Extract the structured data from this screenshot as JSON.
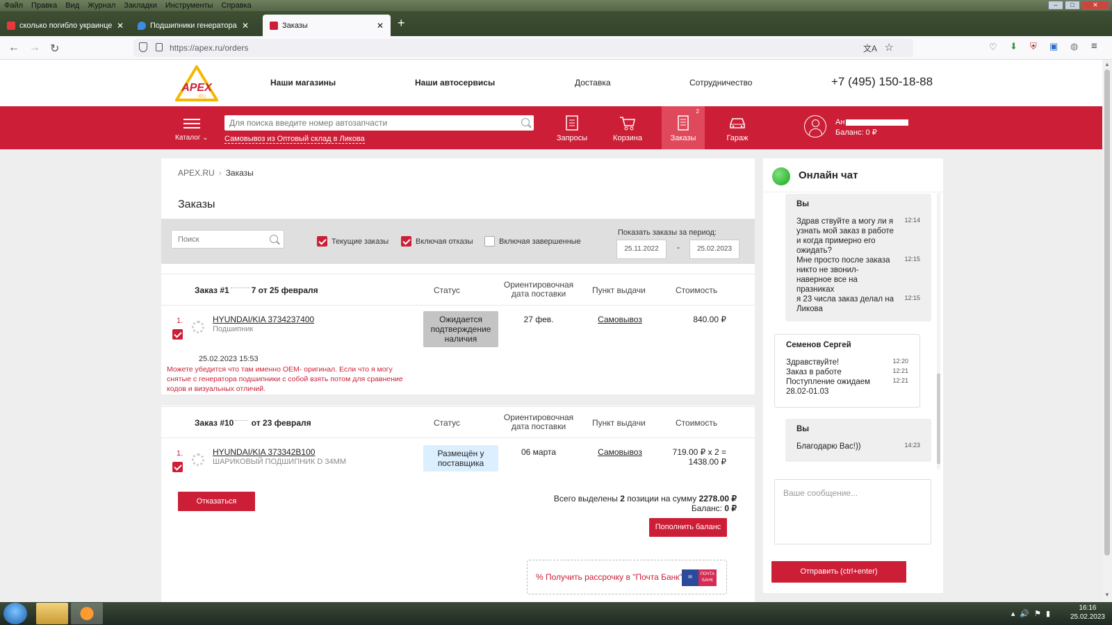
{
  "browser": {
    "menu": [
      "Файл",
      "Правка",
      "Вид",
      "Журнал",
      "Закладки",
      "Инструменты",
      "Справка"
    ],
    "tabs": [
      {
        "title": "сколько погибло украинцев н",
        "active": false,
        "color": "#e8383d"
      },
      {
        "title": "Подшипники генератора - Стр",
        "active": false,
        "color": "#3b8de0"
      },
      {
        "title": "Заказы",
        "active": true,
        "color": "#cc1f37"
      }
    ],
    "url": "https://apex.ru/orders",
    "tab_close": "✕",
    "new_tab": "+"
  },
  "site": {
    "logo_text": "APEX",
    "logo_sub": ".RU",
    "topnav": [
      "Наши магазины",
      "Наши автосервисы",
      "Доставка",
      "Сотрудничество"
    ],
    "phone": "+7 (495) 150-18-88",
    "catalog_label": "Каталог",
    "search_placeholder": "Для поиска введите номер автозапчасти",
    "pickup_point": "Самовывоз из Оптовый склад в Ликова",
    "nav": {
      "requests": "Запросы",
      "cart": "Корзина",
      "orders": "Заказы",
      "orders_badge": "2",
      "garage": "Гараж"
    },
    "user_name": "Ан",
    "user_balance": "Баланс: 0 ₽"
  },
  "main": {
    "breadcrumb": [
      "APEX.RU",
      "Заказы"
    ],
    "title": "Заказы",
    "filters": {
      "search_placeholder": "Поиск",
      "current_label": "Текущие заказы",
      "refusals_label": "Включая отказы",
      "completed_label": "Включая завершенные",
      "period_label": "Показать заказы за период:",
      "date_from": "25.11.2022",
      "date_to": "25.02.2023",
      "dash": "-"
    },
    "columns": {
      "status": "Статус",
      "delivery": "Ориентировочная дата поставки",
      "pickup": "Пункт выдачи",
      "cost": "Стоимость"
    },
    "orders": [
      {
        "title_a": "Заказ #1",
        "title_b": "7  от 25 февраля",
        "num": "1.",
        "part": "HYUNDAI/KIA 3734237400",
        "part_name": "Подшипник",
        "status": "Ожидается подтверждение наличия",
        "delivery": "27 фев.",
        "pickup": "Самовывоз",
        "cost": "840.00 ₽",
        "comment_date": "25.02.2023 15:53",
        "comment": "Можете убедится что там именно OEM- оригинал. Если что я могу снятые с генератора подшипники с собой взять потом для сравнение кодов и визуальных отличий."
      },
      {
        "title_a": "Заказ #10",
        "title_b": " от 23 февраля",
        "num": "1.",
        "part": "HYUNDAI/KIA 373342B100",
        "part_name": "ШАРИКОВЫЙ ПОДШИПНИК D 34MM",
        "status": "Размещён у поставщика",
        "delivery": "06 марта",
        "pickup": "Самовывоз",
        "cost_line1": "719.00 ₽ x 2 =",
        "cost_line2": "1438.00 ₽"
      }
    ],
    "refuse_button": "Отказаться",
    "summary_prefix": "Всего выделены",
    "summary_count": "2",
    "summary_mid": "позиции на сумму",
    "summary_total": "2278.00 ₽",
    "balance_label": "Баланс:",
    "balance_value": "0 ₽",
    "topup_button": "Пополнить баланс",
    "installment_text": "% Получить рассрочку в \"Почта Банк\"",
    "postbank_text": "ПОЧТА БАНК"
  },
  "chat": {
    "title": "Онлайн чат",
    "messages": [
      {
        "who": "Вы",
        "lines": [
          "Здрав ствуйте а могу ли я",
          "узнать мой заказ в работе",
          "и когда примерно его",
          "ожидать?",
          "Мне просто после заказа",
          "никто не звонил-",
          "наверное все на",
          "празниках",
          "я 23 числа заказ делал на",
          "Ликова"
        ],
        "times": [
          "12:14",
          "12:15",
          "12:15"
        ]
      },
      {
        "who": "Семенов Сергей",
        "lines": [
          "Здравствуйте!",
          "Заказ в работе",
          "Поступление ожидаем",
          "28.02-01.03"
        ],
        "times": [
          "12:20",
          "12:21",
          "12:21"
        ]
      },
      {
        "who": "Вы",
        "lines": [
          "Благодарю Вас!))"
        ],
        "times": [
          "14:23"
        ]
      }
    ],
    "input_placeholder": "Ваше сообщение...",
    "send_button": "Отправить (ctrl+enter)"
  },
  "taskbar": {
    "time": "16:16",
    "date": "25.02.2023"
  }
}
